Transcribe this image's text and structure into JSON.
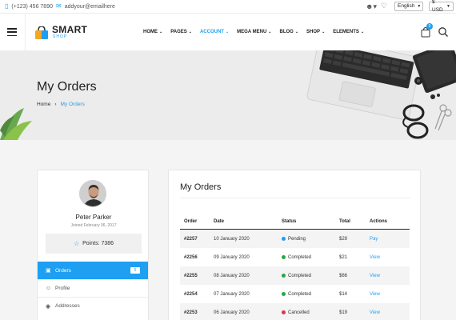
{
  "topbar": {
    "phone": "(+123) 456 7890",
    "email": "addyour@emailhere",
    "language": "English",
    "currency": "$ USD"
  },
  "logo": {
    "name": "SMART",
    "sub": "SHOP"
  },
  "nav": [
    {
      "label": "HOME",
      "active": false
    },
    {
      "label": "PAGES",
      "active": false
    },
    {
      "label": "ACCOUNT",
      "active": true
    },
    {
      "label": "MEGA MENU",
      "active": false
    },
    {
      "label": "BLOG",
      "active": false
    },
    {
      "label": "SHOP",
      "active": false
    },
    {
      "label": "ELEMENTS",
      "active": false
    }
  ],
  "cart": {
    "count": "0"
  },
  "banner": {
    "title": "My Orders",
    "breadcrumb": [
      "Home",
      "My Orders"
    ]
  },
  "profile": {
    "name": "Peter Parker",
    "joined": "Joined February 06, 2017",
    "points": "Points: 7386"
  },
  "menu": [
    {
      "label": "Orders",
      "icon": "calendar-icon",
      "badge": "5",
      "active": true
    },
    {
      "label": "Profile",
      "icon": "user-icon",
      "active": false
    },
    {
      "label": "Addresses",
      "icon": "location-icon",
      "active": false
    }
  ],
  "orders": {
    "title": "My Orders",
    "columns": [
      "Order",
      "Date",
      "Status",
      "Total",
      "Actions"
    ],
    "rows": [
      {
        "id": "#2257",
        "date": "10 January 2020",
        "status": "Pending",
        "status_color": "#1e9ff2",
        "total": "$29",
        "action": "Pay"
      },
      {
        "id": "#2256",
        "date": "09 January 2020",
        "status": "Completed",
        "status_color": "#28a745",
        "total": "$21",
        "action": "View"
      },
      {
        "id": "#2255",
        "date": "08 January 2020",
        "status": "Completed",
        "status_color": "#28a745",
        "total": "$66",
        "action": "View"
      },
      {
        "id": "#2254",
        "date": "07 January 2020",
        "status": "Completed",
        "status_color": "#28a745",
        "total": "$14",
        "action": "View"
      },
      {
        "id": "#2253",
        "date": "06 January 2020",
        "status": "Cancelled",
        "status_color": "#dc3545",
        "total": "$19",
        "action": "View"
      }
    ]
  },
  "colors": {
    "accent": "#1e9ff2",
    "completed": "#28a745",
    "cancelled": "#dc3545"
  }
}
